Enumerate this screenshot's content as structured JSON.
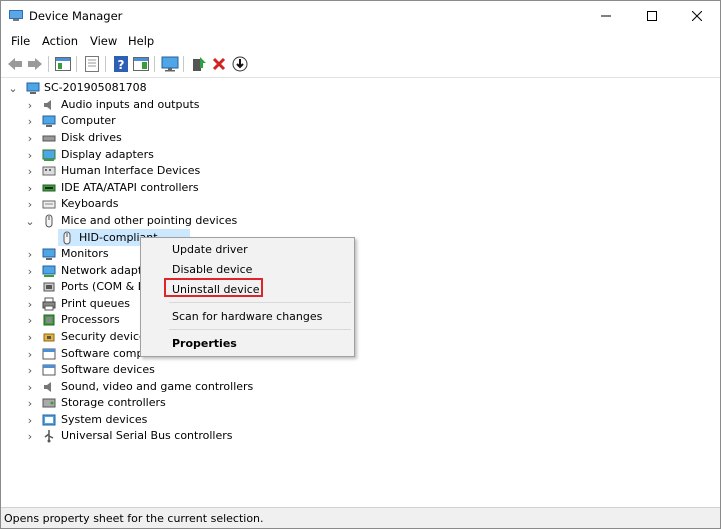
{
  "window": {
    "title": "Device Manager",
    "icon": "device-manager-icon"
  },
  "menu": [
    "File",
    "Action",
    "View",
    "Help"
  ],
  "toolbar": [
    "back-icon",
    "forward-icon",
    "show-hide-tree-icon",
    "properties-icon",
    "help-icon",
    "action-pane-icon",
    "monitor-icon",
    "update-driver-icon",
    "uninstall-icon",
    "download-icon"
  ],
  "tree": {
    "root": "SC-201905081708",
    "items": [
      {
        "label": "Audio inputs and outputs",
        "icon": "speaker-icon"
      },
      {
        "label": "Computer",
        "icon": "computer-icon"
      },
      {
        "label": "Disk drives",
        "icon": "disk-drive-icon"
      },
      {
        "label": "Display adapters",
        "icon": "display-adapter-icon"
      },
      {
        "label": "Human Interface Devices",
        "icon": "hid-icon"
      },
      {
        "label": "IDE ATA/ATAPI controllers",
        "icon": "ide-controller-icon"
      },
      {
        "label": "Keyboards",
        "icon": "keyboard-icon"
      },
      {
        "label": "Mice and other pointing devices",
        "icon": "mouse-icon",
        "expanded": true
      },
      {
        "label": "HID-compliant",
        "icon": "mouse-icon",
        "child": true,
        "selected": true
      },
      {
        "label": "Monitors",
        "icon": "monitor-icon"
      },
      {
        "label": "Network adapte",
        "icon": "network-adapter-icon"
      },
      {
        "label": "Ports (COM & L",
        "icon": "port-icon"
      },
      {
        "label": "Print queues",
        "icon": "printer-icon"
      },
      {
        "label": "Processors",
        "icon": "processor-icon"
      },
      {
        "label": "Security devices",
        "icon": "security-device-icon"
      },
      {
        "label": "Software compone",
        "icon": "software-component-icon"
      },
      {
        "label": "Software devices",
        "icon": "software-device-icon"
      },
      {
        "label": "Sound, video and game controllers",
        "icon": "sound-icon"
      },
      {
        "label": "Storage controllers",
        "icon": "storage-controller-icon"
      },
      {
        "label": "System devices",
        "icon": "system-device-icon"
      },
      {
        "label": "Universal Serial Bus controllers",
        "icon": "usb-icon"
      }
    ]
  },
  "context_menu": {
    "update": "Update driver",
    "disable": "Disable device",
    "uninstall": "Uninstall device",
    "scan": "Scan for hardware changes",
    "properties": "Properties"
  },
  "status": "Opens property sheet for the current selection.",
  "colors": {
    "selection": "#cce8ff",
    "highlight_box": "#e0252a",
    "menu_bg": "#f2f2f2"
  }
}
